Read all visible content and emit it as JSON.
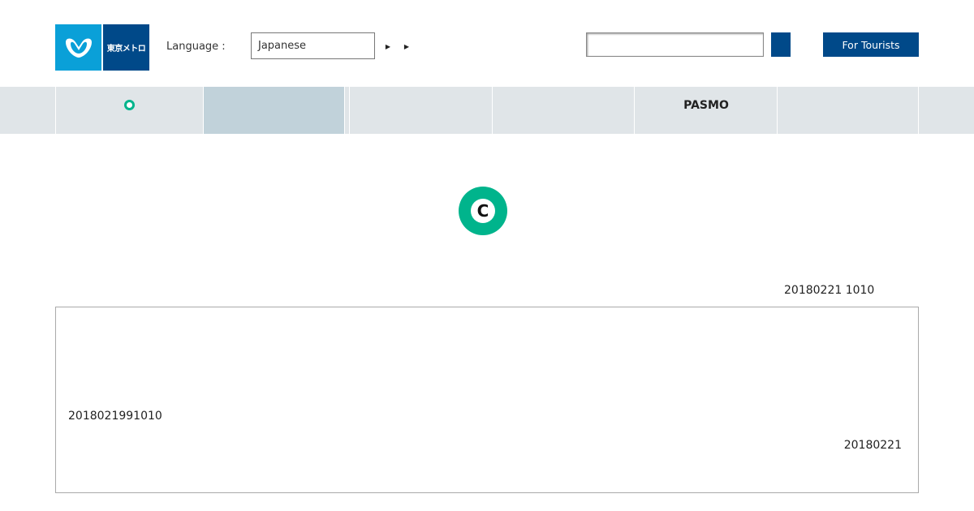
{
  "header": {
    "logo": {
      "mark_icon": "tokyo-metro-heart-m-icon",
      "text": "東京メトロ",
      "brand_color": "#0aa0d8",
      "text_bg_color": "#004989"
    },
    "language_label": "Language :",
    "language_selected": "Japanese",
    "search": {
      "placeholder": "",
      "value": ""
    },
    "tourists_label": "For Tourists"
  },
  "nav": {
    "items": [
      {
        "label": "",
        "icon": "green-dot-icon",
        "active": false
      },
      {
        "label": "",
        "active": true
      },
      {
        "label": "",
        "active": false
      },
      {
        "label": "",
        "active": false
      },
      {
        "label": "PASMO",
        "active": false
      },
      {
        "label": "",
        "active": false
      }
    ]
  },
  "main": {
    "line_logo_letter": "C",
    "line_color": "#00b48c",
    "timestamp": "20180221 1010",
    "notice": {
      "id": "2018021991010",
      "date": "20180221"
    }
  }
}
